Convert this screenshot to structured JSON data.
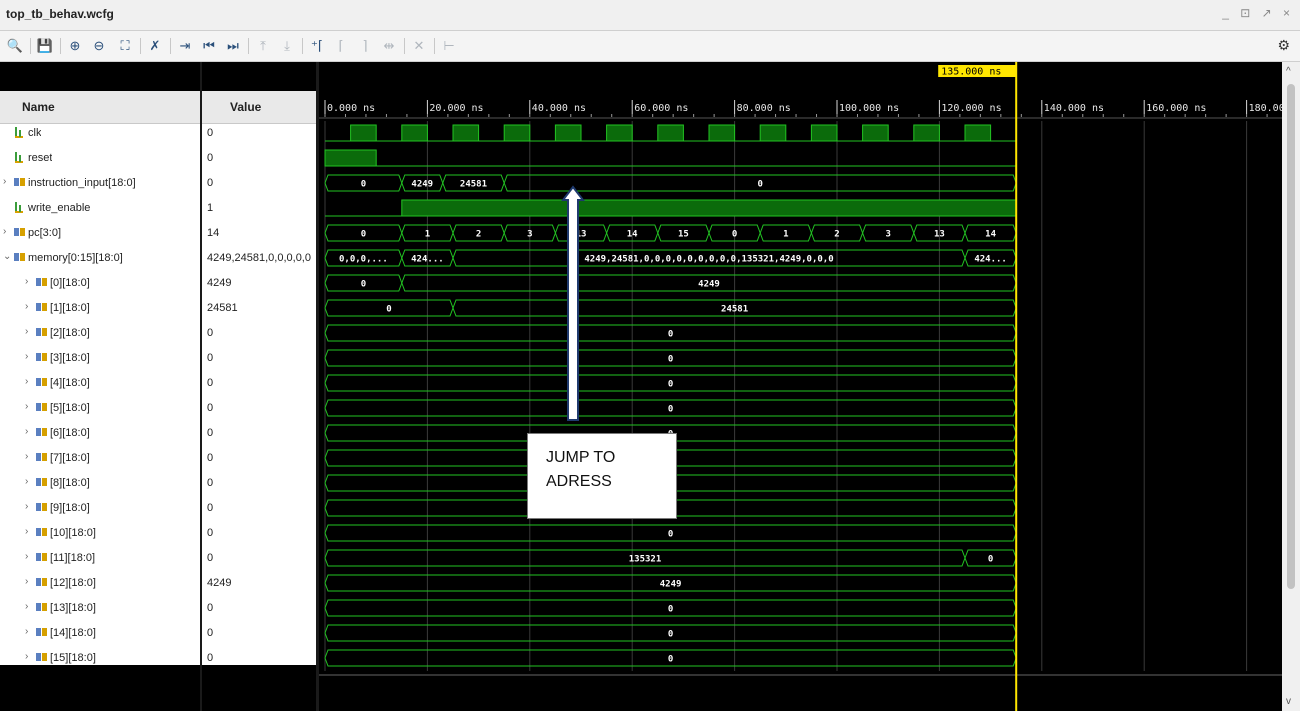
{
  "window": {
    "title": "top_tb_behav.wcfg",
    "controls": "_ ⊡ ↗ ×"
  },
  "toolbar": {
    "icons": [
      "search-icon",
      "save-icon",
      "zoom-in-icon",
      "zoom-out-icon",
      "zoom-fit-icon",
      "cursor-icon",
      "go-to-time-zero-icon",
      "go-to-start-icon",
      "go-to-end-icon",
      "previous-transition-icon",
      "next-transition-icon",
      "add-marker-icon",
      "previous-marker-icon",
      "next-marker-icon",
      "swap-cursors-icon",
      "delete-marker-icon",
      "snap-icon",
      "settings-gear-icon"
    ],
    "glyphs": {
      "search": "🔍",
      "save": "💾",
      "zoomin": "⊕",
      "zoomout": "⊖",
      "fit": "⛶",
      "cursor": "✗",
      "t0": "⇥",
      "start": "⏮",
      "end": "⏭",
      "prevtr": "⤒",
      "nexttr": "⤓",
      "addm": "⁺⌈",
      "prevm": "⌈",
      "nextm": "⌉",
      "swap": "⇹",
      "del": "✕",
      "snap": "⊢",
      "gear": "⚙"
    }
  },
  "headers": {
    "name": "Name",
    "value": "Value"
  },
  "signals": [
    {
      "name": "clk",
      "value": "0",
      "kind": "bit",
      "expand": ""
    },
    {
      "name": "reset",
      "value": "0",
      "kind": "bit",
      "expand": ""
    },
    {
      "name": "instruction_input[18:0]",
      "value": "0",
      "kind": "bus",
      "expand": "›"
    },
    {
      "name": "write_enable",
      "value": "1",
      "kind": "bit",
      "expand": ""
    },
    {
      "name": "pc[3:0]",
      "value": "14",
      "kind": "bus",
      "expand": "›"
    },
    {
      "name": "memory[0:15][18:0]",
      "value": "4249,24581,0,0,0,0,0",
      "kind": "bus",
      "expand": "⌄"
    },
    {
      "name": "[0][18:0]",
      "value": "4249",
      "kind": "bus",
      "expand": "›"
    },
    {
      "name": "[1][18:0]",
      "value": "24581",
      "kind": "bus",
      "expand": "›"
    },
    {
      "name": "[2][18:0]",
      "value": "0",
      "kind": "bus",
      "expand": "›"
    },
    {
      "name": "[3][18:0]",
      "value": "0",
      "kind": "bus",
      "expand": "›"
    },
    {
      "name": "[4][18:0]",
      "value": "0",
      "kind": "bus",
      "expand": "›"
    },
    {
      "name": "[5][18:0]",
      "value": "0",
      "kind": "bus",
      "expand": "›"
    },
    {
      "name": "[6][18:0]",
      "value": "0",
      "kind": "bus",
      "expand": "›"
    },
    {
      "name": "[7][18:0]",
      "value": "0",
      "kind": "bus",
      "expand": "›"
    },
    {
      "name": "[8][18:0]",
      "value": "0",
      "kind": "bus",
      "expand": "›"
    },
    {
      "name": "[9][18:0]",
      "value": "0",
      "kind": "bus",
      "expand": "›"
    },
    {
      "name": "[10][18:0]",
      "value": "0",
      "kind": "bus",
      "expand": "›"
    },
    {
      "name": "[11][18:0]",
      "value": "0",
      "kind": "bus",
      "expand": "›"
    },
    {
      "name": "[12][18:0]",
      "value": "4249",
      "kind": "bus",
      "expand": "›"
    },
    {
      "name": "[13][18:0]",
      "value": "0",
      "kind": "bus",
      "expand": "›"
    },
    {
      "name": "[14][18:0]",
      "value": "0",
      "kind": "bus",
      "expand": "›"
    },
    {
      "name": "[15][18:0]",
      "value": "0",
      "kind": "bus",
      "expand": "›"
    }
  ],
  "timeline": {
    "cursor_label": "135.000 ns",
    "cursor_ns": 135,
    "range_ns": [
      0,
      185
    ],
    "ticks": [
      "0.000 ns",
      "20.000 ns",
      "40.000 ns",
      "60.000 ns",
      "80.000 ns",
      "100.000 ns",
      "120.000 ns",
      "140.000 ns",
      "160.000 ns",
      "180.00"
    ],
    "tick_ns": [
      0,
      20,
      40,
      60,
      80,
      100,
      120,
      140,
      160,
      180
    ],
    "sim_end_ns": 135
  },
  "waves": {
    "clk": {
      "period_ns": 10,
      "high_from_ns": 5,
      "high_ns": 5
    },
    "reset": {
      "high": [
        [
          0,
          10
        ]
      ]
    },
    "write_enable": {
      "high": [
        [
          15,
          135
        ]
      ]
    },
    "instruction_input": [
      [
        "0",
        0,
        15
      ],
      [
        "4249",
        15,
        23
      ],
      [
        "24581",
        23,
        35
      ],
      [
        "0",
        35,
        135
      ]
    ],
    "pc": [
      [
        "0",
        0,
        15
      ],
      [
        "1",
        15,
        25
      ],
      [
        "2",
        25,
        35
      ],
      [
        "3",
        35,
        45
      ],
      [
        "13",
        45,
        55
      ],
      [
        "14",
        55,
        65
      ],
      [
        "15",
        65,
        75
      ],
      [
        "0",
        75,
        85
      ],
      [
        "1",
        85,
        95
      ],
      [
        "2",
        95,
        105
      ],
      [
        "3",
        105,
        115
      ],
      [
        "13",
        115,
        125
      ],
      [
        "14",
        125,
        135
      ]
    ],
    "memory": [
      [
        "0,0,0,...",
        0,
        15
      ],
      [
        "424...",
        15,
        25
      ],
      [
        "4249,24581,0,0,0,0,0,0,0,0,0,135321,4249,0,0,0",
        25,
        125
      ],
      [
        "424...",
        125,
        135
      ]
    ],
    "mem0": [
      [
        "0",
        0,
        15
      ],
      [
        "4249",
        15,
        135
      ]
    ],
    "mem1": [
      [
        "0",
        0,
        25
      ],
      [
        "24581",
        25,
        135
      ]
    ],
    "mem11": [
      [
        "135321",
        0,
        125
      ],
      [
        "0",
        125,
        135
      ]
    ],
    "mem12": [
      [
        "4249",
        0,
        135
      ]
    ],
    "zero": [
      [
        "0",
        0,
        135
      ]
    ]
  },
  "annotation": {
    "text": "JUMP TO ADRESS"
  },
  "colors": {
    "wave": "#22c322",
    "fill": "#0b6b0b",
    "bg": "#000000",
    "cursor": "#ffe600",
    "bustext": "#ffffff"
  }
}
